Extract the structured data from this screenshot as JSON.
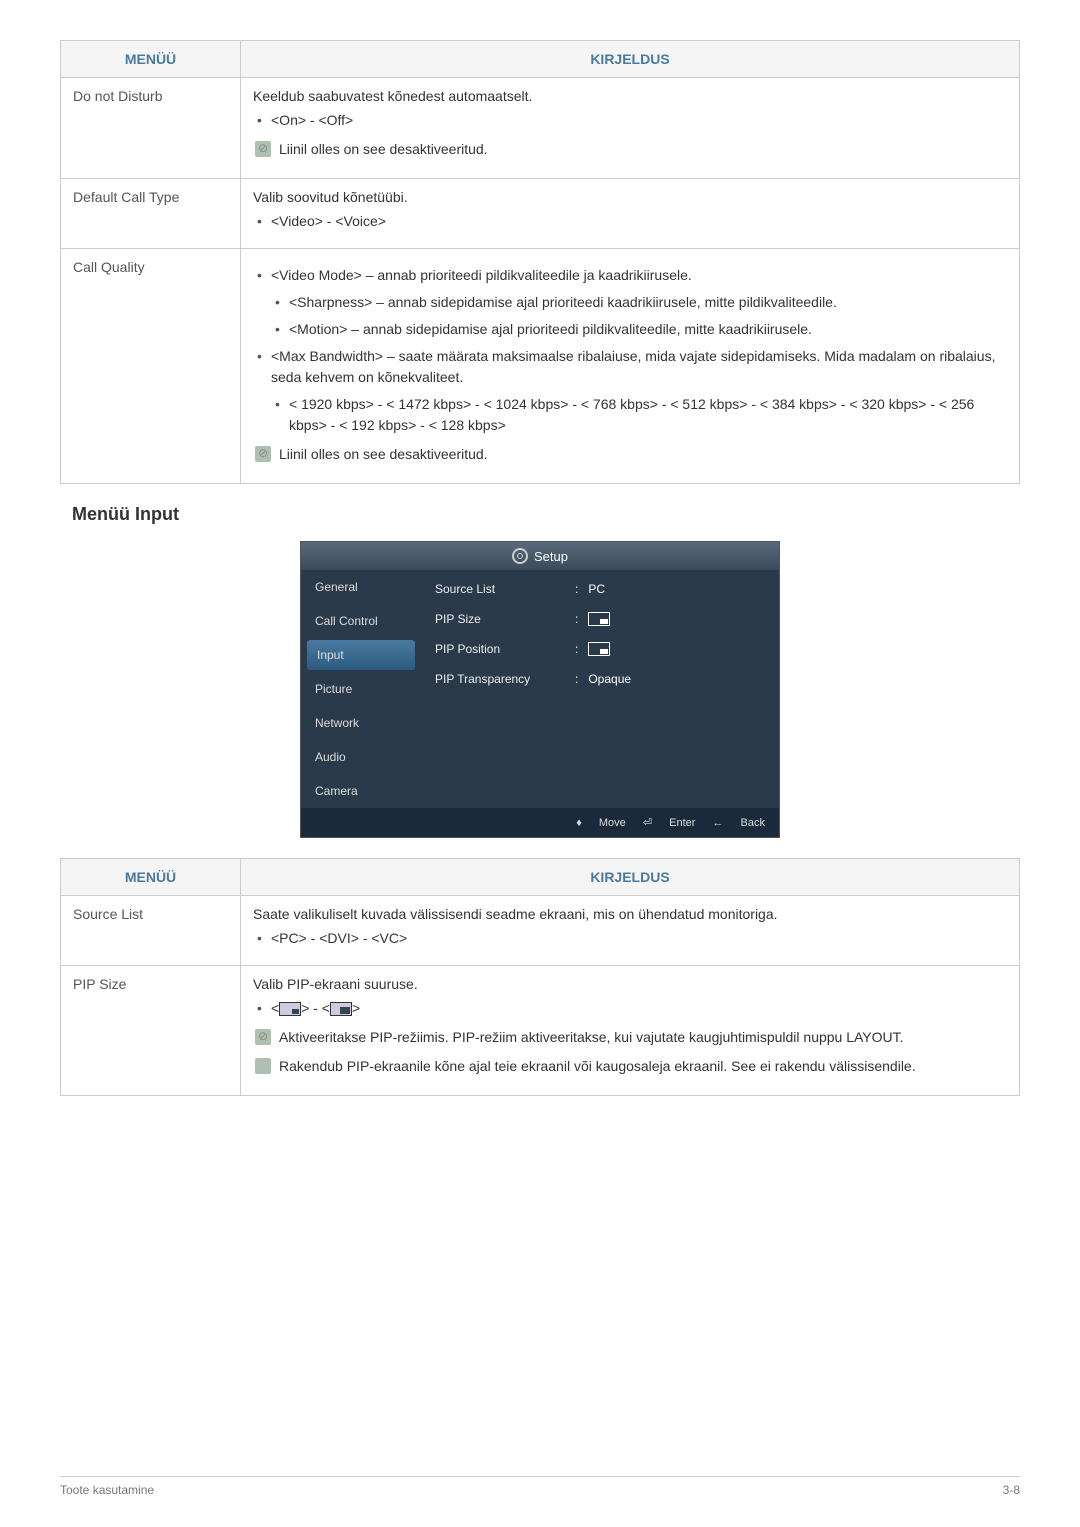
{
  "table1": {
    "headers": {
      "menu": "MENÜÜ",
      "desc": "KIRJELDUS"
    },
    "rows": [
      {
        "menu": "Do not Disturb",
        "desc": "Keeldub saabuvatest kõnedest automaatselt.",
        "bullets": [
          "<On> - <Off>"
        ],
        "note": "Liinil olles on see desaktiveeritud."
      },
      {
        "menu": "Default Call Type",
        "desc": "Valib soovitud kõnetüübi.",
        "bullets": [
          "<Video> - <Voice>"
        ]
      },
      {
        "menu": "Call Quality",
        "bullets_nested": {
          "b1": "<Video Mode> – annab prioriteedi pildikvaliteedile ja kaadrikiirusele.",
          "b1_sub": [
            "<Sharpness> – annab sidepidamise ajal prioriteedi kaadrikiirusele, mitte pildikvaliteedile.",
            "<Motion> – annab sidepidamise ajal prioriteedi pildikvaliteedile, mitte kaadrikiirusele."
          ],
          "b2": "<Max Bandwidth> – saate määrata maksimaalse ribalaiuse, mida vajate sidepidamiseks. Mida madalam on ribalaius, seda kehvem on kõnekvaliteet.",
          "b2_sub": [
            "< 1920 kbps> - < 1472 kbps> - < 1024 kbps> - < 768 kbps> - < 512 kbps> - < 384 kbps> - < 320 kbps> - < 256 kbps> - < 192 kbps> - < 128 kbps>"
          ]
        },
        "note": "Liinil olles on see desaktiveeritud."
      }
    ]
  },
  "section_heading": "Menüü Input",
  "osd": {
    "title": "Setup",
    "nav": [
      "General",
      "Call Control",
      "Input",
      "Picture",
      "Network",
      "Audio",
      "Camera"
    ],
    "active_nav": "Input",
    "rows": [
      {
        "label": "Source List",
        "value": "PC",
        "icon": null
      },
      {
        "label": "PIP Size",
        "value": "",
        "icon": "pip"
      },
      {
        "label": "PIP Position",
        "value": "",
        "icon": "pip"
      },
      {
        "label": "PIP Transparency",
        "value": "Opaque",
        "icon": null
      }
    ],
    "footer": {
      "move": "Move",
      "enter": "Enter",
      "back": "Back"
    }
  },
  "table2": {
    "headers": {
      "menu": "MENÜÜ",
      "desc": "KIRJELDUS"
    },
    "rows": [
      {
        "menu": "Source List",
        "desc": "Saate valikuliselt kuvada välissisendi seadme ekraani, mis on ühendatud monitoriga.",
        "bullets": [
          "<PC> - <DVI> - <VC>"
        ]
      },
      {
        "menu": "PIP Size",
        "desc": "Valib PIP-ekraani suuruse.",
        "bullets_icons": true,
        "note1": "Aktiveeritakse PIP-režiimis. PIP-režiim aktiveeritakse, kui vajutate kaugjuhtimispuldil nuppu LAYOUT.",
        "note2": "Rakendub PIP-ekraanile kõne ajal teie ekraanil või kaugosaleja ekraanil. See ei rakendu välissisendile."
      }
    ]
  },
  "footer": {
    "left": "Toote kasutamine",
    "right": "3-8"
  }
}
